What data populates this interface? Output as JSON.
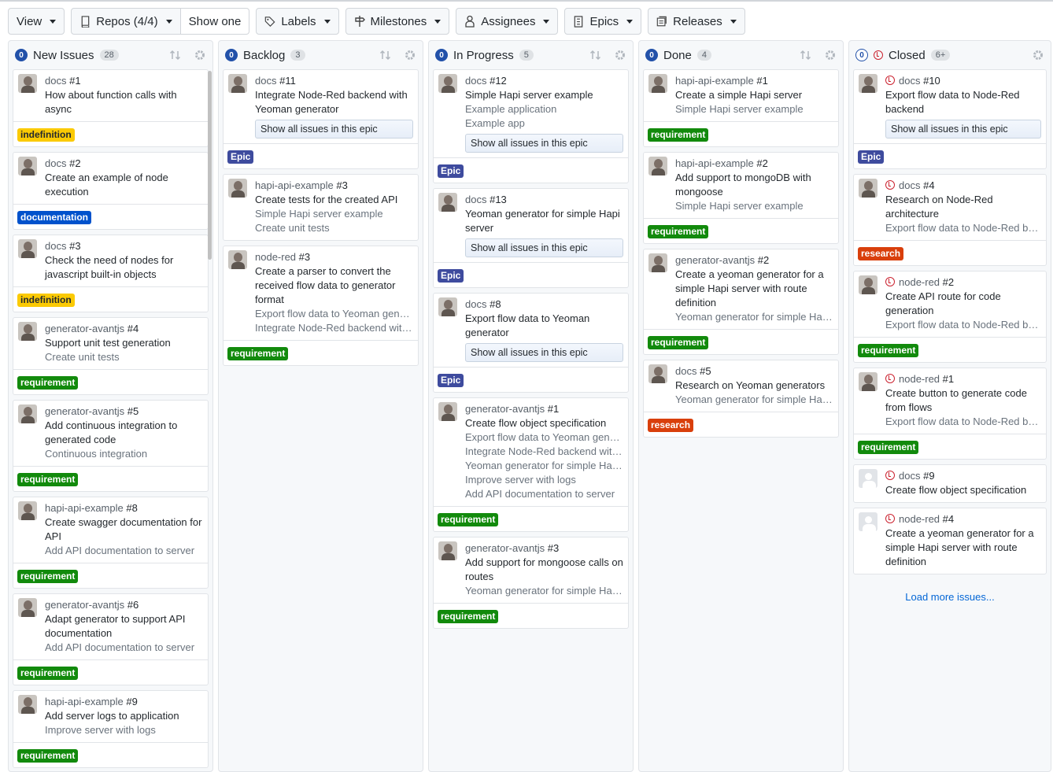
{
  "toolbar": {
    "view": "View",
    "repos": "Repos (4/4)",
    "show_one": "Show one",
    "labels": "Labels",
    "milestones": "Milestones",
    "assignees": "Assignees",
    "epics": "Epics",
    "releases": "Releases"
  },
  "epic_button_label": "Show all issues in this epic",
  "columns": [
    {
      "title": "New Issues",
      "count": "28",
      "badge": "0",
      "cards": [
        {
          "repo": "docs",
          "num": "#1",
          "title": "How about function calls with async",
          "subs": [],
          "label": "indefinition"
        },
        {
          "repo": "docs",
          "num": "#2",
          "title": "Create an example of node execution",
          "subs": [],
          "label": "documentation"
        },
        {
          "repo": "docs",
          "num": "#3",
          "title": "Check the need of nodes for javascript built-in objects",
          "subs": [],
          "label": "indefinition"
        },
        {
          "repo": "generator-avantjs",
          "num": "#4",
          "title": "Support unit test generation",
          "subs": [
            "Create unit tests"
          ],
          "label": "requirement"
        },
        {
          "repo": "generator-avantjs",
          "num": "#5",
          "title": "Add continuous integration to generated code",
          "subs": [
            "Continuous integration"
          ],
          "label": "requirement"
        },
        {
          "repo": "hapi-api-example",
          "num": "#8",
          "title": "Create swagger documentation for API",
          "subs": [
            "Add API documentation to server"
          ],
          "label": "requirement"
        },
        {
          "repo": "generator-avantjs",
          "num": "#6",
          "title": "Adapt generator to support API documentation",
          "subs": [
            "Add API documentation to server"
          ],
          "label": "requirement"
        },
        {
          "repo": "hapi-api-example",
          "num": "#9",
          "title": "Add server logs to application",
          "subs": [
            "Improve server with logs"
          ],
          "label": "requirement"
        }
      ]
    },
    {
      "title": "Backlog",
      "count": "3",
      "badge": "0",
      "cards": [
        {
          "repo": "docs",
          "num": "#11",
          "title": "Integrate Node-Red backend with Yeoman generator",
          "subs": [],
          "epic": true,
          "label": "Epic"
        },
        {
          "repo": "hapi-api-example",
          "num": "#3",
          "title": "Create tests for the created API",
          "subs": [
            "Simple Hapi server example",
            "Create unit tests"
          ]
        },
        {
          "repo": "node-red",
          "num": "#3",
          "title": "Create a parser to convert the received flow data to generator format",
          "subs": [
            "Export flow data to Yeoman gener...",
            "Integrate Node-Red backend with ..."
          ],
          "label": "requirement"
        }
      ]
    },
    {
      "title": "In Progress",
      "count": "5",
      "badge": "0",
      "cards": [
        {
          "repo": "docs",
          "num": "#12",
          "title": "Simple Hapi server example",
          "subs": [
            "Example application",
            "Example app"
          ],
          "epic": true,
          "label": "Epic"
        },
        {
          "repo": "docs",
          "num": "#13",
          "title": "Yeoman generator for simple Hapi server",
          "subs": [],
          "epic": true,
          "label": "Epic"
        },
        {
          "repo": "docs",
          "num": "#8",
          "title": "Export flow data to Yeoman generator",
          "subs": [],
          "epic": true,
          "label": "Epic"
        },
        {
          "repo": "generator-avantjs",
          "num": "#1",
          "title": "Create flow object specification",
          "subs": [
            "Export flow data to Yeoman gener...",
            "Integrate Node-Red backend with ...",
            "Yeoman generator for simple Hapi...",
            "Improve server with logs",
            "Add API documentation to server"
          ],
          "label": "requirement"
        },
        {
          "repo": "generator-avantjs",
          "num": "#3",
          "title": "Add support for mongoose calls on routes",
          "subs": [
            "Yeoman generator for simple Hapi..."
          ],
          "label": "requirement"
        }
      ]
    },
    {
      "title": "Done",
      "count": "4",
      "badge": "0",
      "cards": [
        {
          "repo": "hapi-api-example",
          "num": "#1",
          "title": "Create a simple Hapi server",
          "subs": [
            "Simple Hapi server example"
          ],
          "label": "requirement"
        },
        {
          "repo": "hapi-api-example",
          "num": "#2",
          "title": "Add support to mongoDB with mongoose",
          "subs": [
            "Simple Hapi server example"
          ],
          "label": "requirement"
        },
        {
          "repo": "generator-avantjs",
          "num": "#2",
          "title": "Create a yeoman generator for a simple Hapi server with route definition",
          "subs": [
            "Yeoman generator for simple Hapi..."
          ],
          "label": "requirement"
        },
        {
          "repo": "docs",
          "num": "#5",
          "title": "Research on Yeoman generators",
          "subs": [
            "Yeoman generator for simple Hapi..."
          ],
          "label": "research"
        }
      ]
    },
    {
      "title": "Closed",
      "count": "6+",
      "badge": "0",
      "load_more": "Load more issues...",
      "cards": [
        {
          "repo": "docs",
          "num": "#10",
          "title": "Export flow data to Node-Red backend",
          "subs": [],
          "epic": true,
          "label": "Epic",
          "closed": true
        },
        {
          "repo": "docs",
          "num": "#4",
          "title": "Research on Node-Red architecture",
          "subs": [
            "Export flow data to Node-Red bac..."
          ],
          "label": "research",
          "closed": true
        },
        {
          "repo": "node-red",
          "num": "#2",
          "title": "Create API route for code generation",
          "subs": [
            "Export flow data to Node-Red bac..."
          ],
          "label": "requirement",
          "closed": true
        },
        {
          "repo": "node-red",
          "num": "#1",
          "title": "Create button to generate code from flows",
          "subs": [
            "Export flow data to Node-Red bac..."
          ],
          "label": "requirement",
          "closed": true
        },
        {
          "repo": "docs",
          "num": "#9",
          "title": "Create flow object specification",
          "subs": [],
          "closed": true,
          "blank": true
        },
        {
          "repo": "node-red",
          "num": "#4",
          "title": "Create a yeoman generator for a simple Hapi server with route definition",
          "subs": [],
          "closed": true,
          "blank": true
        }
      ]
    }
  ]
}
